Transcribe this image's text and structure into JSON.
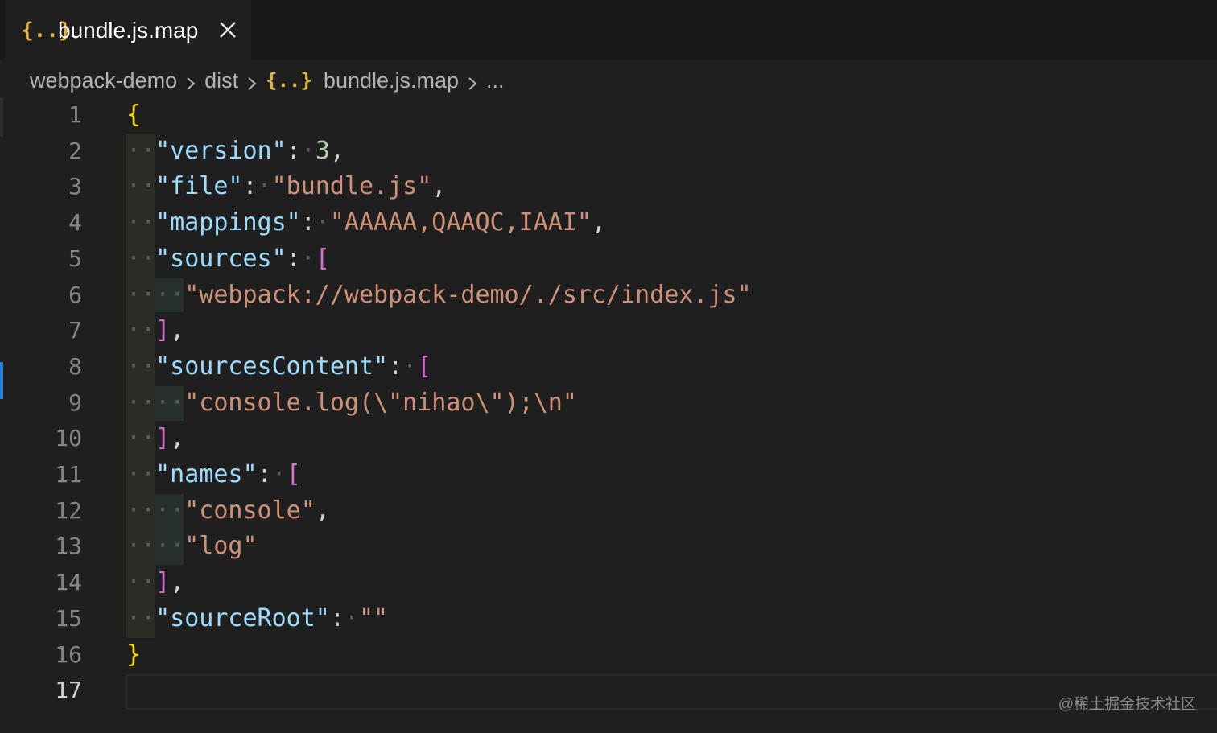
{
  "tab": {
    "icon_text": "{..}",
    "label": "bundle.js.map"
  },
  "breadcrumb": {
    "items": [
      "webpack-demo",
      "dist",
      "bundle.js.map",
      "..."
    ],
    "file_icon_text": "{..}"
  },
  "editor": {
    "active_line": 17,
    "lines": [
      {
        "n": "1"
      },
      {
        "n": "2"
      },
      {
        "n": "3"
      },
      {
        "n": "4"
      },
      {
        "n": "5"
      },
      {
        "n": "6"
      },
      {
        "n": "7"
      },
      {
        "n": "8"
      },
      {
        "n": "9"
      },
      {
        "n": "10"
      },
      {
        "n": "11"
      },
      {
        "n": "12"
      },
      {
        "n": "13"
      },
      {
        "n": "14"
      },
      {
        "n": "15"
      },
      {
        "n": "16"
      },
      {
        "n": "17"
      }
    ],
    "tokens": {
      "open_brace": "{",
      "close_brace": "}",
      "version_key": "\"version\"",
      "version_val": "3",
      "file_key": "\"file\"",
      "file_val": "\"bundle.js\"",
      "mappings_key": "\"mappings\"",
      "mappings_val": "\"AAAAA,QAAQC,IAAI\"",
      "sources_key": "\"sources\"",
      "sources_item": "\"webpack://webpack-demo/./src/index.js\"",
      "sourcesContent_key": "\"sourcesContent\"",
      "sourcesContent_item": "\"console.log(\\\"nihao\\\");\\n\"",
      "names_key": "\"names\"",
      "names_item_1": "\"console\"",
      "names_item_2": "\"log\"",
      "sourceRoot_key": "\"sourceRoot\"",
      "sourceRoot_val": "\"\"",
      "open_bracket": "[",
      "close_bracket": "]",
      "colon": ":",
      "comma": ",",
      "ws_dot": "·"
    }
  },
  "watermark": "@稀土掘金技术社区",
  "colors": {
    "background": "#1f1f1f",
    "key": "#9cdcfe",
    "string": "#ce9178",
    "number": "#b5cea8",
    "brace": "#ffd700",
    "bracket": "#da70d6",
    "json_icon": "#e2b93d"
  }
}
